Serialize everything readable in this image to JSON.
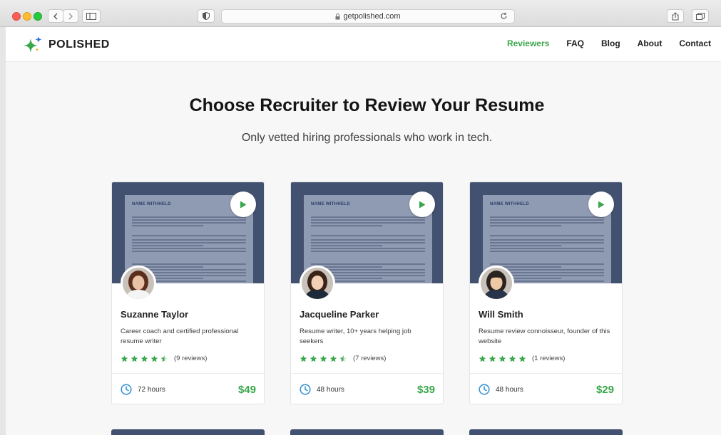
{
  "browser": {
    "url": "getpolished.com"
  },
  "site": {
    "logo_text": "POLISHED",
    "nav": [
      {
        "label": "Reviewers",
        "active": true
      },
      {
        "label": "FAQ",
        "active": false
      },
      {
        "label": "Blog",
        "active": false
      },
      {
        "label": "About",
        "active": false
      },
      {
        "label": "Contact",
        "active": false
      }
    ]
  },
  "hero": {
    "title": "Choose Recruiter to Review Your Resume",
    "subtitle": "Only vetted hiring professionals who work in tech."
  },
  "resume_preview": {
    "name": "NAME WITHHELD"
  },
  "reviewers": [
    {
      "name": "Suzanne Taylor",
      "description": "Career coach and certified professional resume writer",
      "rating": 4.5,
      "reviews": "(9 reviews)",
      "turnaround": "72 hours",
      "price": "$49"
    },
    {
      "name": "Jacqueline Parker",
      "description": "Resume writer, 10+ years helping job seekers",
      "rating": 4.5,
      "reviews": "(7 reviews)",
      "turnaround": "48 hours",
      "price": "$39"
    },
    {
      "name": "Will Smith",
      "description": "Resume review connoisseur, founder of this website",
      "rating": 5,
      "reviews": "(1 reviews)",
      "turnaround": "48 hours",
      "price": "$29"
    }
  ],
  "colors": {
    "accent": "#3aa74b",
    "card_preview": "#435170",
    "star": "#3aa74b",
    "clock": "#3d95d6"
  },
  "icons": [
    "lock-icon",
    "reload-icon",
    "play-icon",
    "star-icon",
    "clock-icon",
    "share-icon",
    "tabs-icon",
    "sidebar-icon"
  ]
}
